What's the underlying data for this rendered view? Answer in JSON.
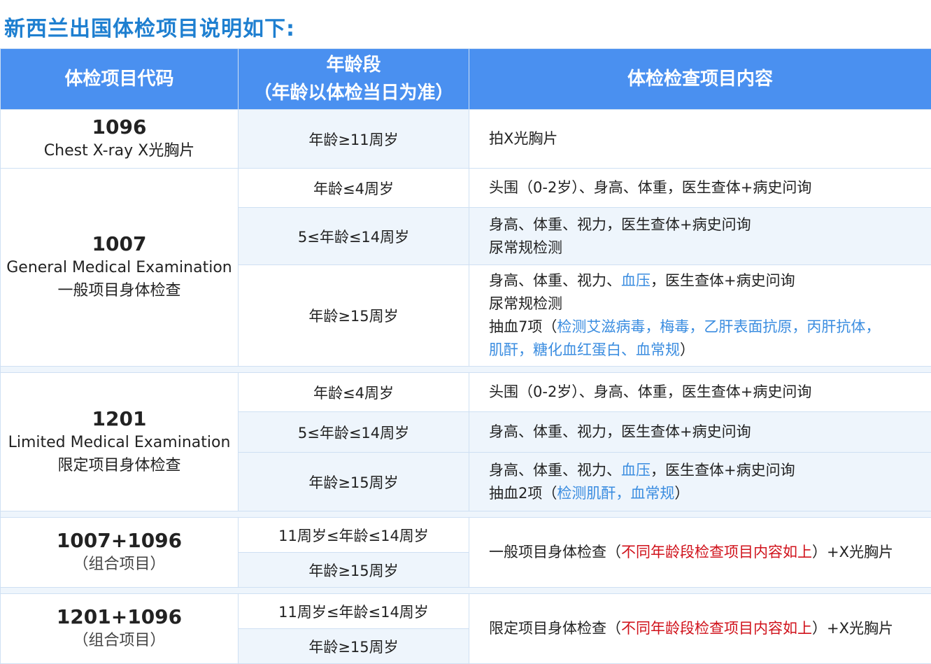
{
  "title": "新西兰出国体检项目说明如下:",
  "headers": {
    "code": "体检项目代码",
    "age_line1": "年龄段",
    "age_line2": "（年龄以体检当日为准）",
    "content": "体检检查项目内容"
  },
  "groups": [
    {
      "code": "1096",
      "name_en": "Chest X-ray  X光胸片",
      "rows": [
        {
          "age": "年龄≥11周岁",
          "lines": [
            [
              {
                "t": "拍X光胸片"
              }
            ]
          ]
        }
      ]
    },
    {
      "code": "1007",
      "name_en": "General Medical Examination",
      "name_cn": "一般项目身体检查",
      "rows": [
        {
          "age": "年龄≤4周岁",
          "lines": [
            [
              {
                "t": "头围（0-2岁）、身高、体重，医生查体+病史问询"
              }
            ]
          ]
        },
        {
          "age": "5≤年龄≤14周岁",
          "lines": [
            [
              {
                "t": "身高、体重、视力，医生查体+病史问询"
              }
            ],
            [
              {
                "t": "尿常规检测"
              }
            ]
          ]
        },
        {
          "age": "年龄≥15周岁",
          "lines": [
            [
              {
                "t": "身高、体重、视力、"
              },
              {
                "t": "血压",
                "c": "blue"
              },
              {
                "t": "，医生查体+病史问询"
              }
            ],
            [
              {
                "t": "尿常规检测"
              }
            ],
            [
              {
                "t": "抽血7项（"
              },
              {
                "t": "检测艾滋病毒，梅毒，乙肝表面抗原，丙肝抗体，",
                "c": "blue"
              }
            ],
            [
              {
                "t": "肌酐，糖化血红蛋白、血常规",
                "c": "blue"
              },
              {
                "t": "）"
              }
            ]
          ]
        }
      ]
    },
    {
      "code": "1201",
      "name_en": "Limited Medical Examination",
      "name_cn": "限定项目身体检查",
      "rows": [
        {
          "age": "年龄≤4周岁",
          "lines": [
            [
              {
                "t": "头围（0-2岁）、身高、体重，医生查体+病史问询"
              }
            ]
          ]
        },
        {
          "age": "5≤年龄≤14周岁",
          "lines": [
            [
              {
                "t": "身高、体重、视力，医生查体+病史问询"
              }
            ]
          ]
        },
        {
          "age": "年龄≥15周岁",
          "lines": [
            [
              {
                "t": "身高、体重、视力、"
              },
              {
                "t": "血压",
                "c": "blue"
              },
              {
                "t": "，医生查体+病史问询"
              }
            ],
            [
              {
                "t": "抽血2项（"
              },
              {
                "t": "检测肌酐，血常规",
                "c": "blue"
              },
              {
                "t": "）"
              }
            ]
          ]
        }
      ]
    },
    {
      "code": "1007+1096",
      "name_cn": "（组合项目）",
      "ages": [
        "11周岁≤年龄≤14周岁",
        "年龄≥15周岁"
      ],
      "lines": [
        [
          {
            "t": "一般项目身体检查（"
          },
          {
            "t": "不同年龄段检查项目内容如上",
            "c": "red"
          },
          {
            "t": "）+X光胸片"
          }
        ]
      ]
    },
    {
      "code": "1201+1096",
      "name_cn": "（组合项目）",
      "ages": [
        "11周岁≤年龄≤14周岁",
        "年龄≥15周岁"
      ],
      "lines": [
        [
          {
            "t": "限定项目身体检查（"
          },
          {
            "t": "不同年龄段检查项目内容如上",
            "c": "red"
          },
          {
            "t": "）+X光胸片"
          }
        ]
      ]
    }
  ]
}
